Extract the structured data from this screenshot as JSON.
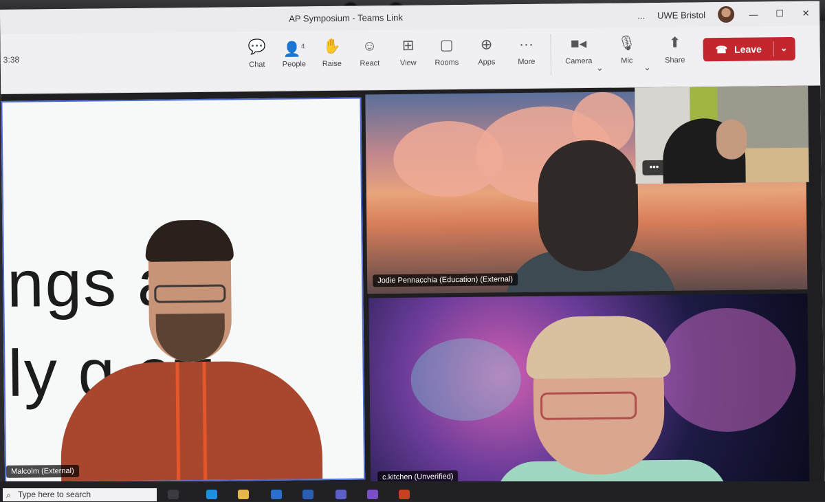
{
  "window": {
    "title": "AP Symposium - Teams Link",
    "org": "UWE Bristol",
    "more_dots": "...",
    "minimize": "—",
    "maximize": "☐",
    "close": "✕"
  },
  "meeting": {
    "timer": "3:38",
    "people_count": "4"
  },
  "toolbar": {
    "chat": "Chat",
    "people": "People",
    "raise": "Raise",
    "react": "React",
    "view": "View",
    "rooms": "Rooms",
    "apps": "Apps",
    "more": "More",
    "camera": "Camera",
    "mic": "Mic",
    "share": "Share",
    "leave": "Leave"
  },
  "slide": {
    "line1": "ngs   an",
    "line2": "ly  g   ett"
  },
  "participants": {
    "presenter": "Malcolm (External)",
    "jodie": "Jodie Pennacchia (Education) (External)",
    "kitchen": "c.kitchen (Unverified)",
    "more_options": "•••"
  },
  "taskbar": {
    "search_placeholder": "Type here to search"
  },
  "colors": {
    "leave": "#c4262e",
    "share_border": "#4f6bd8"
  }
}
